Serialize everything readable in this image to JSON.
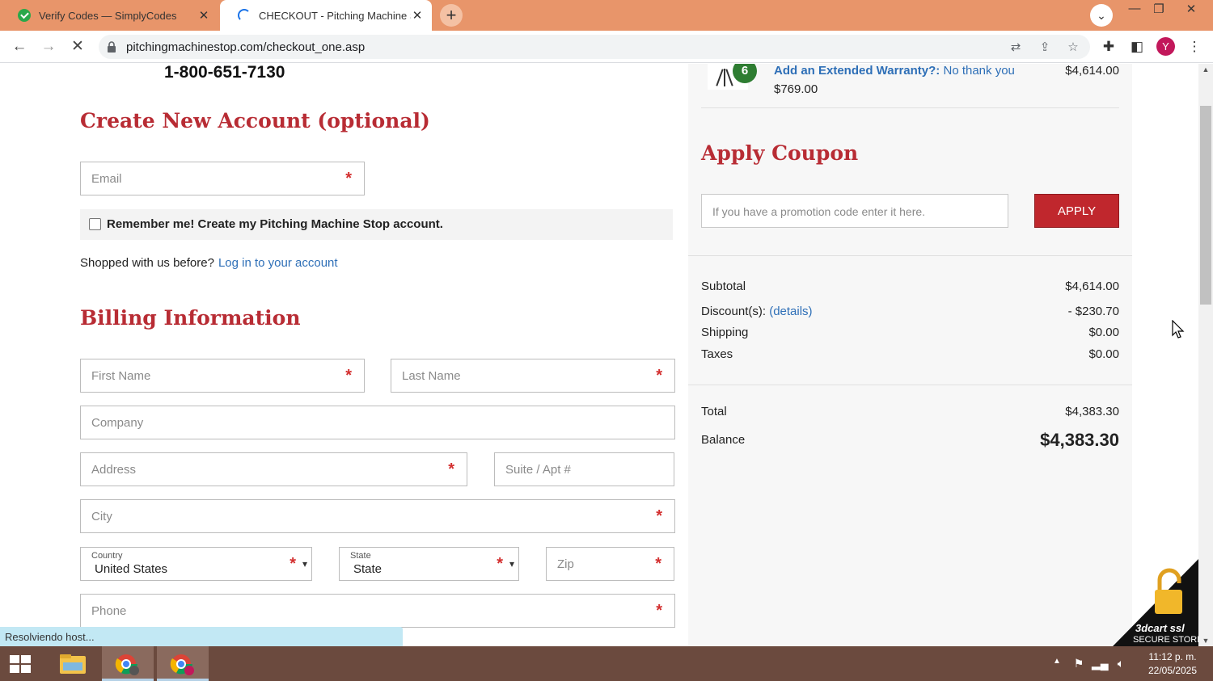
{
  "browser": {
    "tabs": [
      {
        "title": "Verify Codes — SimplyCodes",
        "active": false
      },
      {
        "title": "CHECKOUT - Pitching Machine Sto",
        "active": true
      }
    ],
    "new_tab": "+",
    "url": "pitchingmachinestop.com/checkout_one.asp",
    "profile_initial": "Y",
    "status_text": "Resolviendo host..."
  },
  "page": {
    "phone": "1-800-651-7130",
    "account_section": {
      "title": "Create New Account (optional)",
      "email_placeholder": "Email",
      "remember_label": "Remember me! Create my Pitching Machine Stop account.",
      "shopped_text": "Shopped with us before?",
      "login_link": "Log in to your account"
    },
    "billing_section": {
      "title": "Billing Information",
      "first_name": "First Name",
      "last_name": "Last Name",
      "company": "Company",
      "address": "Address",
      "suite": "Suite / Apt #",
      "city": "City",
      "country_label": "Country",
      "country_value": "United States",
      "state_label": "State",
      "state_value": "State",
      "zip": "Zip",
      "phone": "Phone",
      "required_mark": "*"
    }
  },
  "sidebar": {
    "item": {
      "quantity": "6",
      "warranty_label": "Add an Extended Warranty?:",
      "warranty_value": "No thank you",
      "unit_price": "$769.00",
      "line_total": "$4,614.00"
    },
    "coupon": {
      "title": "Apply Coupon",
      "placeholder": "If you have a promotion code enter it here.",
      "button": "APPLY"
    },
    "summary": {
      "subtotal_label": "Subtotal",
      "subtotal": "$4,614.00",
      "discount_label": "Discount(s):",
      "discount_link": "(details)",
      "discount": "- $230.70",
      "shipping_label": "Shipping",
      "shipping": "$0.00",
      "taxes_label": "Taxes",
      "taxes": "$0.00",
      "total_label": "Total",
      "total": "$4,383.30",
      "balance_label": "Balance",
      "balance": "$4,383.30"
    },
    "ssl_badge": {
      "line1": "3dcart ssl",
      "line2": "SECURE STORE"
    }
  },
  "taskbar": {
    "time": "11:12 p. m.",
    "date": "22/05/2025"
  },
  "colors": {
    "tabbar": "#e8956a",
    "heading_red": "#b82c34",
    "apply_button": "#c0272d",
    "link_blue": "#2e6fb7",
    "taskbar": "#6b4a3e"
  }
}
